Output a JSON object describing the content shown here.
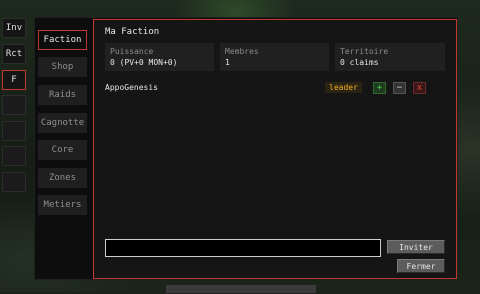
{
  "left_column": {
    "items": [
      {
        "label": "Inv",
        "active": false
      },
      {
        "label": "Rct",
        "active": false
      },
      {
        "label": "F",
        "active": true
      },
      {
        "label": "",
        "active": false
      },
      {
        "label": "",
        "active": false
      },
      {
        "label": "",
        "active": false
      },
      {
        "label": "",
        "active": false
      }
    ]
  },
  "tabs": [
    {
      "label": "Faction",
      "active": true
    },
    {
      "label": "Shop",
      "active": false
    },
    {
      "label": "Raids",
      "active": false
    },
    {
      "label": "Cagnotte",
      "active": false
    },
    {
      "label": "Core",
      "active": false
    },
    {
      "label": "Zones",
      "active": false
    },
    {
      "label": "Metiers",
      "active": false
    }
  ],
  "content": {
    "title": "Ma Faction",
    "stats": [
      {
        "label": "Puissance",
        "value": "0 (PV+0 MON+0)"
      },
      {
        "label": "Membres",
        "value": "1"
      },
      {
        "label": "Territoire",
        "value": "0 claims"
      }
    ],
    "members": [
      {
        "name": "AppoGenesis",
        "role": "leader",
        "promote": "+",
        "demote": "−",
        "kick": "x"
      }
    ],
    "invite_input": {
      "value": "",
      "placeholder": ""
    },
    "invite_button": "Inviter",
    "close_button": "Fermer"
  },
  "colors": {
    "accent": "#c0392b",
    "leader": "#f0b020",
    "promote": "#4cd04c",
    "kick": "#e24a3a"
  }
}
